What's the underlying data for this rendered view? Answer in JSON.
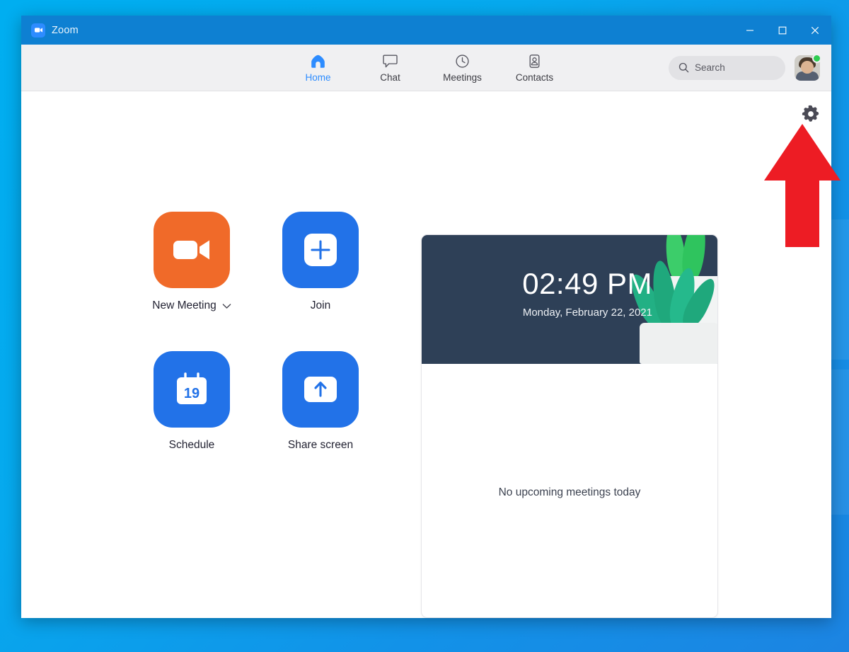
{
  "window": {
    "title": "Zoom",
    "app_icon": "video-camera-icon",
    "controls": {
      "minimize": "minimize-icon",
      "maximize": "maximize-icon",
      "close": "close-icon"
    }
  },
  "nav": {
    "tabs": [
      {
        "label": "Home",
        "icon": "home-icon",
        "active": true
      },
      {
        "label": "Chat",
        "icon": "chat-icon",
        "active": false
      },
      {
        "label": "Meetings",
        "icon": "clock-icon",
        "active": false
      },
      {
        "label": "Contacts",
        "icon": "contacts-icon",
        "active": false
      }
    ],
    "search": {
      "placeholder": "Search",
      "value": "",
      "icon": "search-icon"
    },
    "avatar": {
      "name": "user-avatar",
      "status": "available",
      "status_color": "#2ecc51"
    }
  },
  "content": {
    "settings_icon": "gear-icon",
    "actions": [
      {
        "label": "New Meeting",
        "icon": "video-camera-icon",
        "color": "#f06a29",
        "has_dropdown": true,
        "dropdown_icon": "chevron-down-icon"
      },
      {
        "label": "Join",
        "icon": "plus-icon",
        "color": "#2272e8",
        "has_dropdown": false
      },
      {
        "label": "Schedule",
        "icon": "calendar-icon",
        "color": "#2272e8",
        "has_dropdown": false,
        "calendar_day": "19"
      },
      {
        "label": "Share screen",
        "icon": "up-arrow-icon",
        "color": "#2272e8",
        "has_dropdown": false
      }
    ],
    "meetings_card": {
      "time": "02:49 PM",
      "date": "Monday, February 22, 2021",
      "banner_color": "#2e4057",
      "empty_state": "No upcoming meetings today"
    },
    "annotation": {
      "type": "up-arrow-annotation",
      "color": "#ed1c24",
      "points_at": "gear-icon"
    }
  }
}
